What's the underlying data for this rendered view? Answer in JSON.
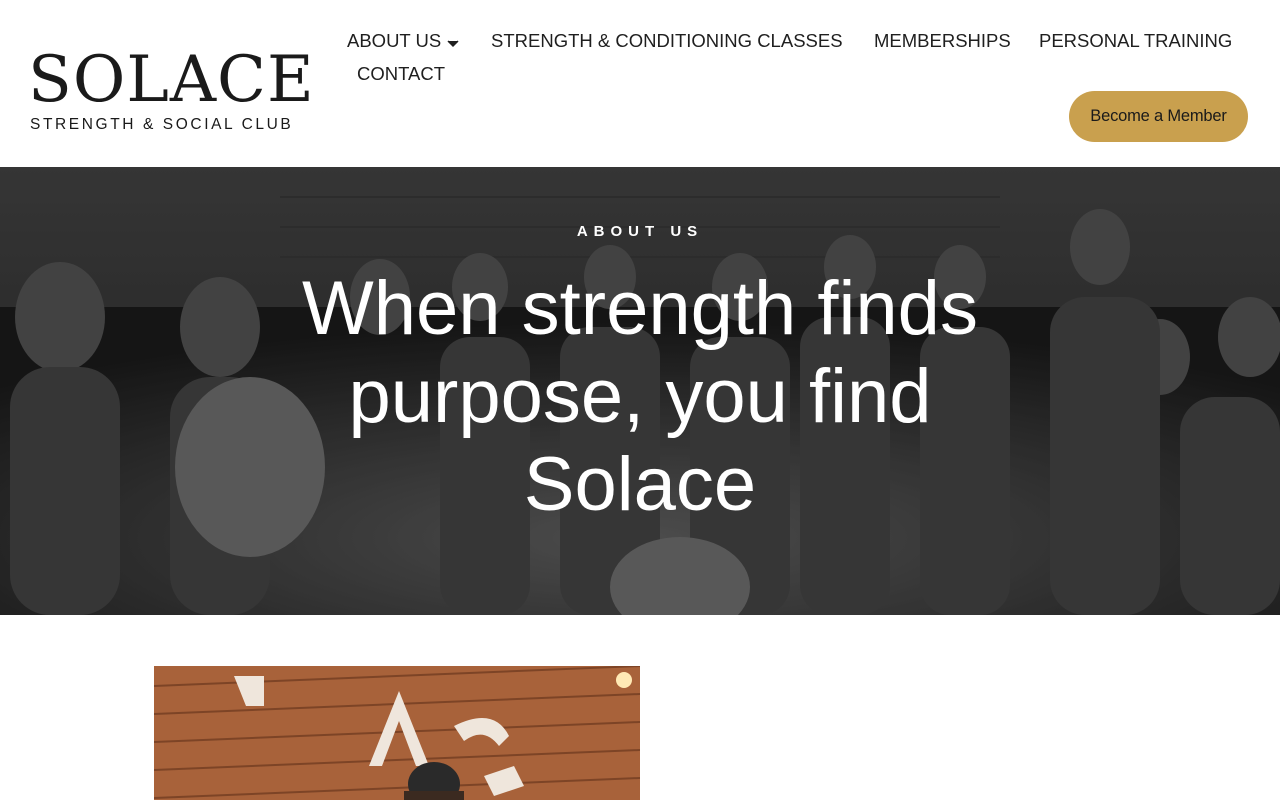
{
  "brand": {
    "name": "SOLACE",
    "tagline": "STRENGTH & SOCIAL CLUB"
  },
  "nav": {
    "items": [
      {
        "label": "ABOUT US",
        "has_dropdown": true
      },
      {
        "label": "STRENGTH & CONDITIONING CLASSES"
      },
      {
        "label": "MEMBERSHIPS"
      },
      {
        "label": "PERSONAL TRAINING"
      },
      {
        "label": "CONTACT"
      }
    ],
    "dropdown_icon": "chevron-down-icon"
  },
  "cta": {
    "label": "Become a Member",
    "color": "#c9a04e"
  },
  "hero": {
    "eyebrow": "ABOUT US",
    "title": "When strength finds purpose, you find Solace"
  },
  "colors": {
    "accent": "#c9a04e",
    "text": "#1f1f1f",
    "hero_text": "#ffffff"
  }
}
